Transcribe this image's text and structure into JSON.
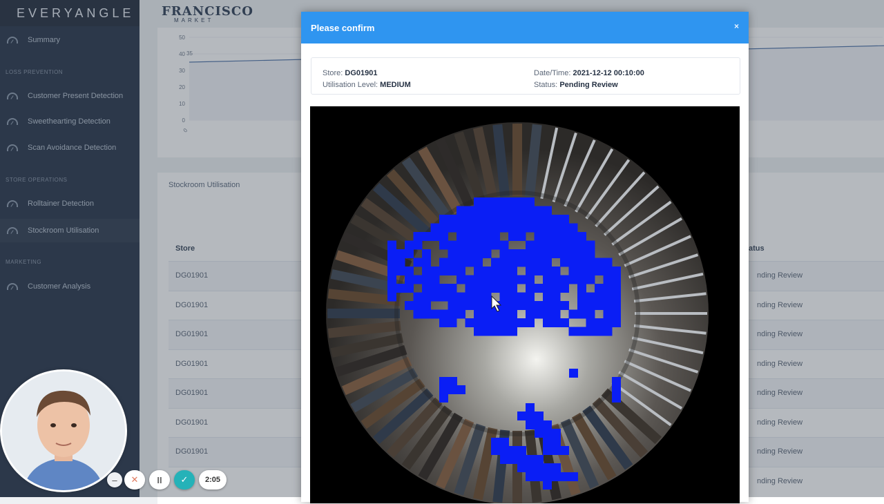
{
  "sidebar": {
    "brand": "EVERYANGLE",
    "summary": "Summary",
    "sections": [
      {
        "title": "LOSS PREVENTION",
        "items": [
          "Customer Present Detection",
          "Sweethearting Detection",
          "Scan Avoidance Detection"
        ]
      },
      {
        "title": "STORE OPERATIONS",
        "items": [
          "Rolltainer Detection",
          "Stockroom Utilisation"
        ]
      },
      {
        "title": "MARKETING",
        "items": [
          "Customer Analysis"
        ]
      }
    ],
    "active_item": "Stockroom Utilisation"
  },
  "logo": {
    "line1": "FRANCISCO",
    "line2": "MARKET"
  },
  "chart_data": {
    "type": "line",
    "y_ticks": [
      "0",
      "10",
      "20",
      "30",
      "40",
      "50"
    ],
    "annotation": "35",
    "x_tick": "0",
    "ylim": [
      0,
      50
    ]
  },
  "table": {
    "title": "Stockroom Utilisation",
    "headers": [
      "Store",
      "atus"
    ],
    "rows": [
      [
        "DG01901",
        "nding Review"
      ],
      [
        "DG01901",
        "nding Review"
      ],
      [
        "DG01901",
        "nding Review"
      ],
      [
        "DG01901",
        "nding Review"
      ],
      [
        "DG01901",
        "nding Review"
      ],
      [
        "DG01901",
        "nding Review"
      ],
      [
        "DG01901",
        "nding Review"
      ],
      [
        "",
        "nding Review"
      ]
    ]
  },
  "modal": {
    "title": "Please confirm",
    "close": "×",
    "store_label": "Store:",
    "store_value": "DG01901",
    "level_label": "Utilisation Level:",
    "level_value": "MEDIUM",
    "datetime_label": "Date/Time:",
    "datetime_value": "2021-12-12 00:10:00",
    "status_label": "Status:",
    "status_value": "Pending Review"
  },
  "controls": {
    "minus": "–",
    "cancel": "✕",
    "pause": "II",
    "confirm": "✓",
    "timer": "2:05"
  },
  "colors": {
    "overlay_blue": "#0a1ef5",
    "header_blue": "#2f95f0",
    "sidebar_bg": "#233044",
    "confirm_teal": "#25b2b8"
  }
}
